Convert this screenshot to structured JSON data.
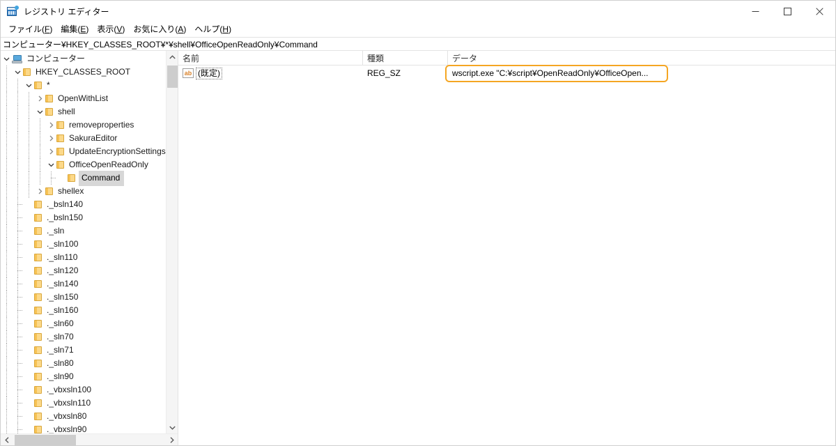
{
  "window": {
    "title": "レジストリ エディター",
    "icon": "registry-editor-icon",
    "controls": {
      "minimize": "minimize-icon",
      "maximize": "maximize-icon",
      "close": "close-icon"
    }
  },
  "menubar": {
    "items": [
      {
        "label_pre": "ファイル(",
        "accel": "F",
        "label_post": ")"
      },
      {
        "label_pre": "編集(",
        "accel": "E",
        "label_post": ")"
      },
      {
        "label_pre": "表示(",
        "accel": "V",
        "label_post": ")"
      },
      {
        "label_pre": "お気に入り(",
        "accel": "A",
        "label_post": ")"
      },
      {
        "label_pre": "ヘルプ(",
        "accel": "H",
        "label_post": ")"
      }
    ]
  },
  "addressbar": {
    "path": "コンピューター¥HKEY_CLASSES_ROOT¥*¥shell¥OfficeOpenReadOnly¥Command"
  },
  "tree": {
    "items": [
      {
        "label": "コンピューター",
        "depth": 0,
        "twisty": "expanded",
        "icon": "computer-icon"
      },
      {
        "label": "HKEY_CLASSES_ROOT",
        "depth": 1,
        "twisty": "expanded",
        "icon": "folder-icon"
      },
      {
        "label": "*",
        "depth": 2,
        "twisty": "expanded",
        "icon": "folder-icon"
      },
      {
        "label": "OpenWithList",
        "depth": 3,
        "twisty": "collapsed",
        "icon": "folder-icon"
      },
      {
        "label": "shell",
        "depth": 3,
        "twisty": "expanded",
        "icon": "folder-icon"
      },
      {
        "label": "removeproperties",
        "depth": 4,
        "twisty": "collapsed",
        "icon": "folder-icon"
      },
      {
        "label": "SakuraEditor",
        "depth": 4,
        "twisty": "collapsed",
        "icon": "folder-icon"
      },
      {
        "label": "UpdateEncryptionSettings",
        "depth": 4,
        "twisty": "collapsed",
        "icon": "folder-icon"
      },
      {
        "label": "OfficeOpenReadOnly",
        "depth": 4,
        "twisty": "expanded",
        "icon": "folder-icon"
      },
      {
        "label": "Command",
        "depth": 5,
        "twisty": "leaf",
        "icon": "folder-icon",
        "selected": true
      },
      {
        "label": "shellex",
        "depth": 3,
        "twisty": "collapsed",
        "icon": "folder-icon"
      },
      {
        "label": "._bsln140",
        "depth": 2,
        "twisty": "leaf",
        "icon": "folder-icon"
      },
      {
        "label": "._bsln150",
        "depth": 2,
        "twisty": "leaf",
        "icon": "folder-icon"
      },
      {
        "label": "._sln",
        "depth": 2,
        "twisty": "leaf",
        "icon": "folder-icon"
      },
      {
        "label": "._sln100",
        "depth": 2,
        "twisty": "leaf",
        "icon": "folder-icon"
      },
      {
        "label": "._sln110",
        "depth": 2,
        "twisty": "leaf",
        "icon": "folder-icon"
      },
      {
        "label": "._sln120",
        "depth": 2,
        "twisty": "leaf",
        "icon": "folder-icon"
      },
      {
        "label": "._sln140",
        "depth": 2,
        "twisty": "leaf",
        "icon": "folder-icon"
      },
      {
        "label": "._sln150",
        "depth": 2,
        "twisty": "leaf",
        "icon": "folder-icon"
      },
      {
        "label": "._sln160",
        "depth": 2,
        "twisty": "leaf",
        "icon": "folder-icon"
      },
      {
        "label": "._sln60",
        "depth": 2,
        "twisty": "leaf",
        "icon": "folder-icon"
      },
      {
        "label": "._sln70",
        "depth": 2,
        "twisty": "leaf",
        "icon": "folder-icon"
      },
      {
        "label": "._sln71",
        "depth": 2,
        "twisty": "leaf",
        "icon": "folder-icon"
      },
      {
        "label": "._sln80",
        "depth": 2,
        "twisty": "leaf",
        "icon": "folder-icon"
      },
      {
        "label": "._sln90",
        "depth": 2,
        "twisty": "leaf",
        "icon": "folder-icon"
      },
      {
        "label": "._vbxsln100",
        "depth": 2,
        "twisty": "leaf",
        "icon": "folder-icon"
      },
      {
        "label": "._vbxsln110",
        "depth": 2,
        "twisty": "leaf",
        "icon": "folder-icon"
      },
      {
        "label": "._vbxsln80",
        "depth": 2,
        "twisty": "leaf",
        "icon": "folder-icon"
      },
      {
        "label": "._vbxsln90",
        "depth": 2,
        "twisty": "leaf",
        "icon": "folder-icon"
      }
    ]
  },
  "value_list": {
    "columns": [
      "名前",
      "種類",
      "データ"
    ],
    "rows": [
      {
        "icon": "string-value-icon",
        "icon_glyph": "ab",
        "name": "(既定)",
        "type": "REG_SZ",
        "data": "wscript.exe \"C:¥script¥OpenReadOnly¥OfficeOpen..."
      }
    ]
  },
  "annotation": {
    "name": "data-value-highlight",
    "color": "#f5a623"
  }
}
